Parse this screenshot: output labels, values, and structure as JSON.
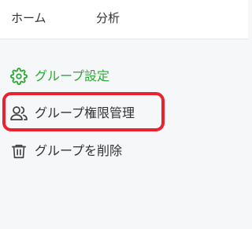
{
  "header": {
    "tabs": [
      {
        "label": "ホーム"
      },
      {
        "label": "分析"
      }
    ]
  },
  "menu": {
    "items": [
      {
        "label": "グループ設定",
        "icon": "gear-icon",
        "color": "#2ea838"
      },
      {
        "label": "グループ権限管理",
        "icon": "users-icon",
        "color": "#333333",
        "highlighted": true
      },
      {
        "label": "グループを削除",
        "icon": "trash-icon",
        "color": "#333333"
      }
    ]
  },
  "colors": {
    "accent": "#2ea838",
    "highlight_border": "#e8232f",
    "background": "#f6f7f9",
    "text": "#333333"
  }
}
